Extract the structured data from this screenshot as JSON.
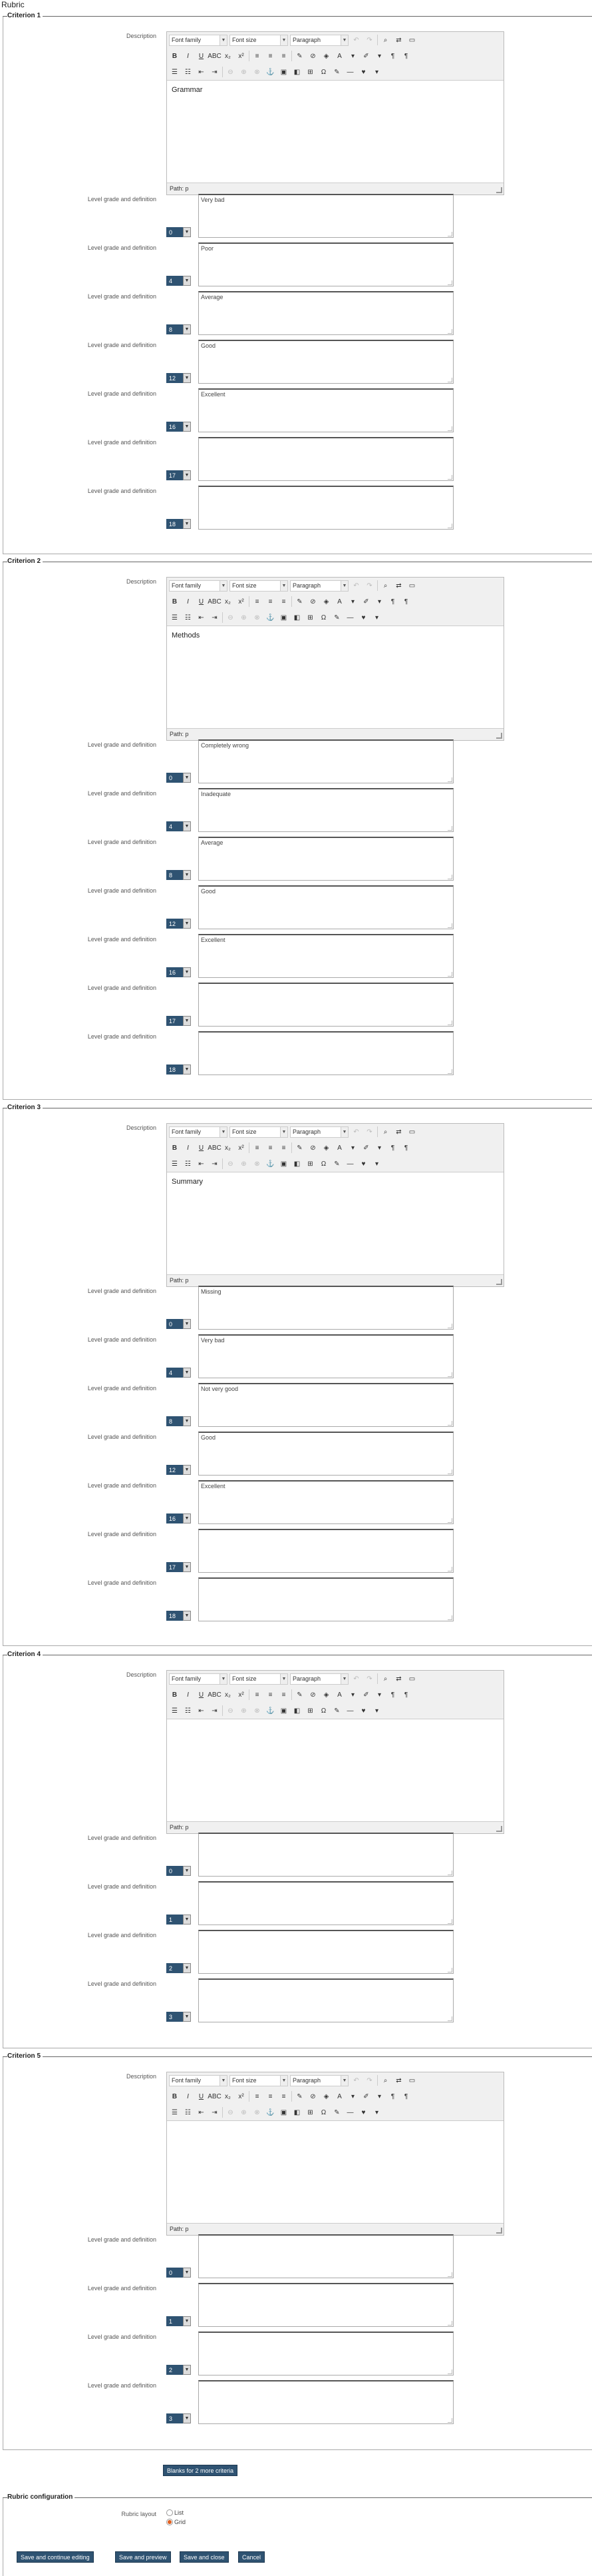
{
  "page": {
    "title": "Rubric"
  },
  "editor_toolbar": {
    "font_family": "Font family",
    "font_size": "Font size",
    "format": "Paragraph",
    "path_label": "Path: p"
  },
  "labels": {
    "description": "Description",
    "level": "Level grade and definition"
  },
  "criteria": [
    {
      "legend": "Criterion 1",
      "description": "Grammar",
      "levels": [
        {
          "score": "0",
          "text": "Very bad"
        },
        {
          "score": "4",
          "text": "Poor"
        },
        {
          "score": "8",
          "text": "Average"
        },
        {
          "score": "12",
          "text": "Good"
        },
        {
          "score": "16",
          "text": "Excellent"
        },
        {
          "score": "17",
          "text": ""
        },
        {
          "score": "18",
          "text": ""
        }
      ]
    },
    {
      "legend": "Criterion 2",
      "description": "Methods",
      "levels": [
        {
          "score": "0",
          "text": "Completely wrong"
        },
        {
          "score": "4",
          "text": "Inadequate"
        },
        {
          "score": "8",
          "text": "Average"
        },
        {
          "score": "12",
          "text": "Good"
        },
        {
          "score": "16",
          "text": "Excellent"
        },
        {
          "score": "17",
          "text": ""
        },
        {
          "score": "18",
          "text": ""
        }
      ]
    },
    {
      "legend": "Criterion 3",
      "description": "Summary",
      "levels": [
        {
          "score": "0",
          "text": "Missing"
        },
        {
          "score": "4",
          "text": "Very bad"
        },
        {
          "score": "8",
          "text": "Not very good"
        },
        {
          "score": "12",
          "text": "Good"
        },
        {
          "score": "16",
          "text": "Excellent"
        },
        {
          "score": "17",
          "text": ""
        },
        {
          "score": "18",
          "text": ""
        }
      ]
    },
    {
      "legend": "Criterion 4",
      "description": "",
      "levels": [
        {
          "score": "0",
          "text": ""
        },
        {
          "score": "1",
          "text": ""
        },
        {
          "score": "2",
          "text": ""
        },
        {
          "score": "3",
          "text": ""
        }
      ]
    },
    {
      "legend": "Criterion 5",
      "description": "",
      "levels": [
        {
          "score": "0",
          "text": ""
        },
        {
          "score": "1",
          "text": ""
        },
        {
          "score": "2",
          "text": ""
        },
        {
          "score": "3",
          "text": ""
        }
      ]
    }
  ],
  "add_criteria_button": "Blanks for 2 more criteria",
  "config": {
    "legend": "Rubric configuration",
    "layout_label": "Rubric layout",
    "options": [
      "List",
      "Grid"
    ],
    "selected": "Grid"
  },
  "actions": {
    "save_continue": "Save and continue editing",
    "save_preview": "Save and preview",
    "save_close": "Save and close",
    "cancel": "Cancel"
  }
}
